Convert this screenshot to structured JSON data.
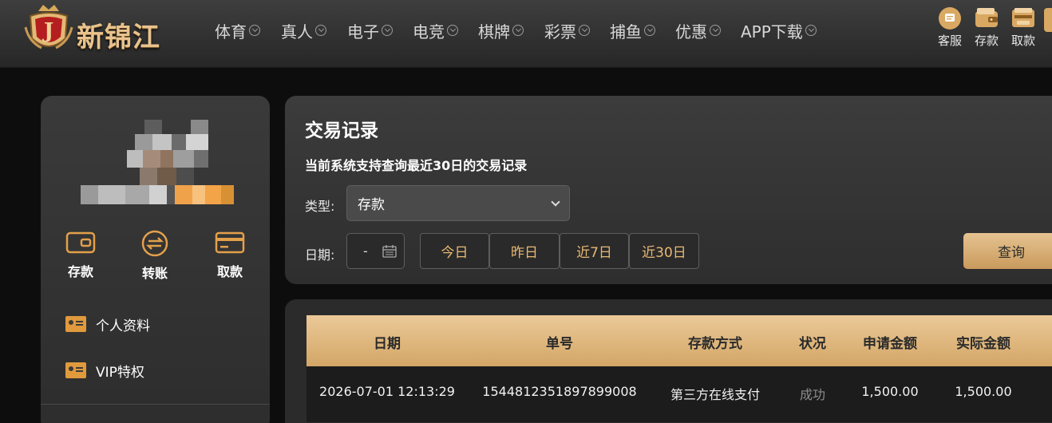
{
  "brand": {
    "name": "新锦江",
    "badge_letter": "J"
  },
  "nav": [
    {
      "label": "体育"
    },
    {
      "label": "真人"
    },
    {
      "label": "电子"
    },
    {
      "label": "电竞"
    },
    {
      "label": "棋牌"
    },
    {
      "label": "彩票"
    },
    {
      "label": "捕鱼"
    },
    {
      "label": "优惠"
    },
    {
      "label": "APP下载"
    }
  ],
  "header_actions": [
    {
      "label": "客服",
      "icon": "chat-icon"
    },
    {
      "label": "存款",
      "icon": "wallet-icon"
    },
    {
      "label": "取款",
      "icon": "atm-icon"
    }
  ],
  "sidebar": {
    "actions": [
      {
        "label": "存款",
        "icon": "wallet-icon"
      },
      {
        "label": "转账",
        "icon": "transfer-icon"
      },
      {
        "label": "取款",
        "icon": "card-icon"
      }
    ],
    "menu": [
      {
        "label": "个人资料",
        "icon": "id-card-icon"
      },
      {
        "label": "VIP特权",
        "icon": "id-card-icon"
      }
    ]
  },
  "filter": {
    "title": "交易记录",
    "note": "当前系统支持查询最近30日的交易记录",
    "type_label": "类型:",
    "type_value": "存款",
    "date_label": "日期:",
    "date_value": "-",
    "quick_ranges": [
      "今日",
      "昨日",
      "近7日",
      "近30日"
    ],
    "search_label": "查询"
  },
  "table": {
    "columns": [
      "日期",
      "单号",
      "存款方式",
      "状况",
      "申请金额",
      "实际金额"
    ],
    "rows": [
      [
        "2026-07-01 12:13:29",
        "1544812351897899008",
        "第三方在线支付",
        "成功",
        "1,500.00",
        "1,500.00"
      ]
    ]
  },
  "colors": {
    "accent": "#e9b873",
    "header_gold": "#d3a666",
    "panel_bg": "#333333"
  }
}
